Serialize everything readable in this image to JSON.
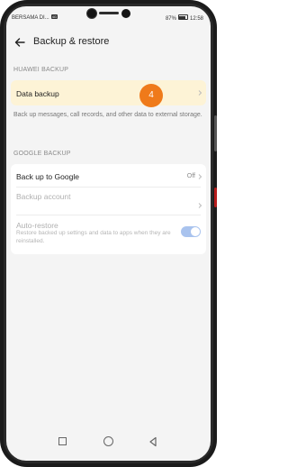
{
  "status_bar": {
    "carrier": "BERSAMA DI...",
    "network": "4G",
    "battery": "87%",
    "time": "12:58"
  },
  "header": {
    "title": "Backup & restore"
  },
  "huawei_backup": {
    "section_label": "HUAWEI BACKUP",
    "data_backup_label": "Data backup",
    "description": "Back up messages, call records, and other data to external storage."
  },
  "google_backup": {
    "section_label": "GOOGLE BACKUP",
    "back_up_to_google_label": "Back up to Google",
    "back_up_to_google_value": "Off",
    "backup_account_label": "Backup account",
    "auto_restore_label": "Auto-restore",
    "auto_restore_desc": "Restore backed up settings and data to apps when they are reinstalled.",
    "auto_restore_on": true
  },
  "step_badge": "4",
  "colors": {
    "highlight": "#fdf3d6",
    "badge": "#ef7a1a",
    "toggle": "#a9c3ee"
  },
  "icons": [
    "back-arrow-icon",
    "chevron-right-icon",
    "nav-recent-icon",
    "nav-home-icon",
    "nav-back-icon"
  ]
}
